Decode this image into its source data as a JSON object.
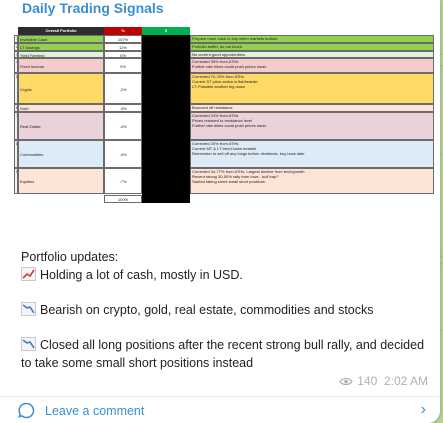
{
  "channel_title": "Daily Trading Signals",
  "sheet": {
    "headers": {
      "portfolio": "Overall Portfolio",
      "percent": "%",
      "dollar": "$",
      "notes": ""
    },
    "header_colors": {
      "portfolio": "#2d2d2d",
      "percent": "#c00000",
      "dollar": "#00b050"
    },
    "rows": [
      {
        "num": "1",
        "asset": "Investible Cash",
        "pct": "107%",
        "color": "#92d050",
        "notes": [
          "Prepare more cash to buy when markets bottom."
        ]
      },
      {
        "num": "2",
        "asset": "LT Savings",
        "pct": "12%",
        "color": "#92d050",
        "notes": [
          "Portfolio buffer, do not touch."
        ]
      },
      {
        "num": "3",
        "asset": "Yield Farming",
        "pct": "0%",
        "color": "#e2efda",
        "notes": [
          "No current good opportunities."
        ]
      },
      {
        "num": "4",
        "asset": "Fixed Income",
        "pct": "0%",
        "color": "#f4cccc",
        "notes": [
          "Corrected 35% from ATHs",
          "Further rate hikes could push prices lower"
        ]
      },
      {
        "num": "5",
        "asset": "Crypto",
        "pct": "-2%",
        "color": "#ffd966",
        "notes": [
          "Corrected 70-78% from ATHs",
          "Current ST price action is flat/bearish",
          "LT: Possible another leg down"
        ]
      },
      {
        "num": "6",
        "asset": "Gold",
        "pct": "-3%",
        "color": "#fce4d6",
        "notes": [
          "Bounced off resistance"
        ]
      },
      {
        "num": "7",
        "asset": "Real Estate",
        "pct": "-4%",
        "color": "#ead1dc",
        "notes": [
          "Corrected 24% from ATHs",
          "Prices retraced to resistance level",
          "Further rate hikes could push prices lower"
        ]
      },
      {
        "num": "8",
        "asset": "Commodities",
        "pct": "-4%",
        "color": "#ddebf7",
        "notes": [
          "Corrected 25% from ATHs",
          "Current MT & LT trend looks bearish",
          "Remember to sell off any longs before dividends, buy back later"
        ]
      },
      {
        "num": "9",
        "asset": "Equities",
        "pct": "-7%",
        "color": "#fce4d6",
        "notes": [
          "Corrected 34-77% from ATHs. Largest decline from tech/growth",
          "Recent strong 30-50% rally from lows - bull trap?",
          "Started taking some small short positions"
        ]
      }
    ],
    "total_pct": "100%"
  },
  "message": {
    "intro": "Portfolio updates:",
    "line1": "Holding a lot of cash, mostly in USD.",
    "line2": "Bearish on crypto, gold, real estate, commodities and stocks",
    "line3": "Closed all long positions after the recent strong bull rally, and decided to take some small short positions instead",
    "emoji1": "chart-increasing-icon",
    "emoji2": "chart-decreasing-icon",
    "emoji3": "chart-decreasing-icon"
  },
  "meta": {
    "views": "140",
    "time": "2:02 AM"
  },
  "footer": {
    "comment_label": "Leave a comment"
  },
  "colors": {
    "accent": "#3a8fd0",
    "muted": "#a9b3bb",
    "background": "#b9cf9c"
  }
}
